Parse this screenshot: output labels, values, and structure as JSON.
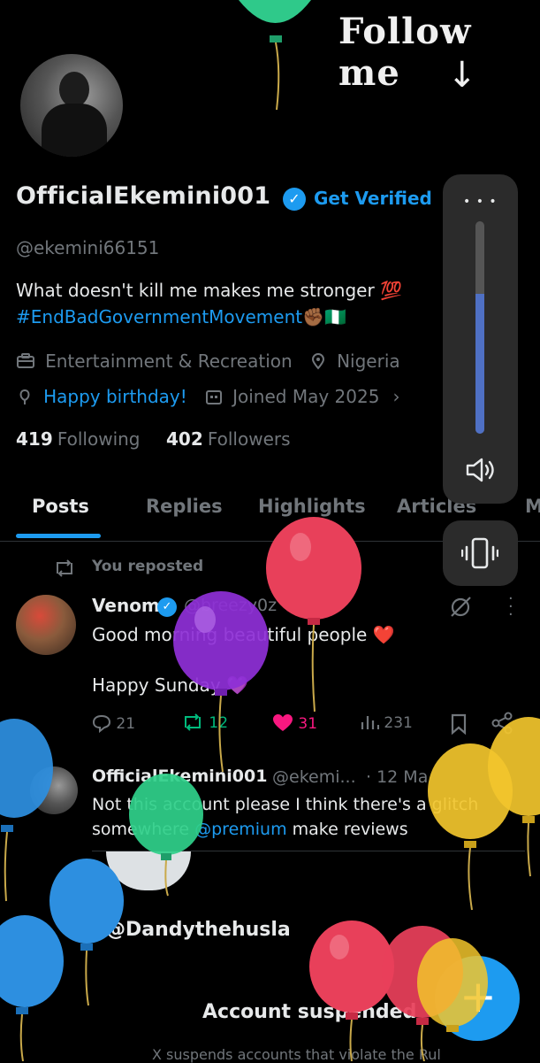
{
  "overlay": {
    "follow_text": "Follow me",
    "arrow": "↓"
  },
  "profile": {
    "display_name": "OfficialEkemini001",
    "verified_badge": "✓",
    "get_verified": "Get Verified",
    "handle": "@ekemini66151",
    "bio_line1": "What doesn't kill me makes me stronger 💯",
    "bio_line2": "#EndBadGovernmentMovement✊🏾🇳🇬",
    "category": "Entertainment & Recreation",
    "location": "Nigeria",
    "birthday_link": "Happy birthday!",
    "joined": "Joined May 2025",
    "following_count": "419",
    "following_label": "Following",
    "followers_count": "402",
    "followers_label": "Followers"
  },
  "tabs": [
    {
      "label": "Posts",
      "active": true
    },
    {
      "label": "Replies"
    },
    {
      "label": "Highlights"
    },
    {
      "label": "Articles"
    },
    {
      "label": "M"
    }
  ],
  "volume_panel": {
    "more": "• • •",
    "level_percent": 66
  },
  "posts": [
    {
      "repost_label": "You reposted",
      "author": "Venom",
      "handle": "@breezy0z",
      "time": "· 4d",
      "text1": "Good morning beautiful people ❤️",
      "text2": "Happy Sunday 💜",
      "replies": "21",
      "reposts": "12",
      "likes": "31",
      "views": "231"
    },
    {
      "author": "OfficialEkemini001",
      "handle": "@ekemi...",
      "time": "· 12 Ma",
      "text1": "Not this account please I think there's a glitch",
      "text2_prefix": "somewhere",
      "text2_mention": "@premium",
      "text2_suffix": " make reviews"
    }
  ],
  "quoted": {
    "handle": "@Dandythehusla",
    "title": "Account suspended",
    "note": "X suspends accounts that violate the Rul"
  },
  "fab": "+",
  "colors": {
    "accent": "#1d9bf0",
    "muted": "#71767b",
    "repost_green": "#00ba7c",
    "like_pink": "#f91880"
  }
}
